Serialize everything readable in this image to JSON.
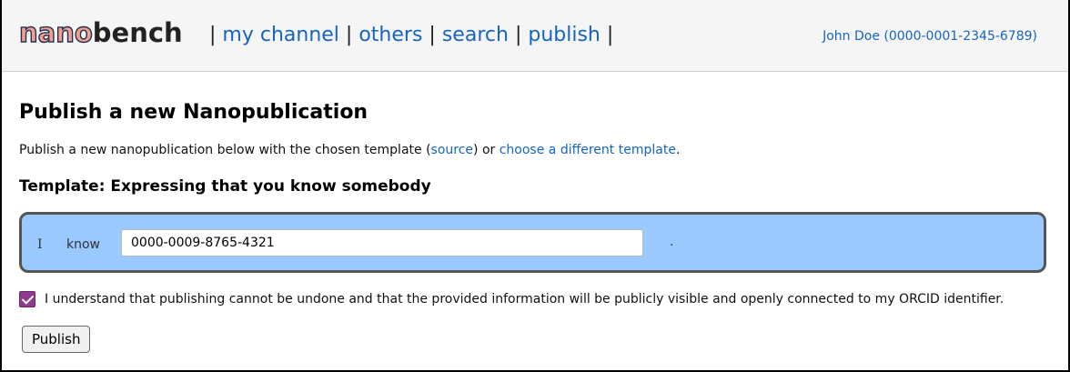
{
  "header": {
    "logo": {
      "part1": "nano",
      "part2": "bench"
    },
    "nav": {
      "sep": "|",
      "items": [
        {
          "label": "my channel"
        },
        {
          "label": "others"
        },
        {
          "label": "search"
        },
        {
          "label": "publish"
        }
      ]
    },
    "user": "John Doe (0000-0001-2345-6789)"
  },
  "main": {
    "title": "Publish a new Nanopublication",
    "intro": {
      "before": "Publish a new nanopublication below with the chosen template (",
      "source_link": "source",
      "middle": ") or ",
      "change_link": "choose a different template",
      "after": "."
    },
    "template_heading": "Template: Expressing that you know somebody",
    "statement": {
      "subject": "I",
      "predicate": "know",
      "object_value": "0000-0009-8765-4321",
      "terminator": "."
    },
    "consent": {
      "checked": true,
      "text": "I understand that publishing cannot be undone and that the provided information will be publicly visible and openly connected to my ORCID identifier."
    },
    "publish_button": "Publish"
  },
  "colors": {
    "link": "#1565c0",
    "statement_bg": "#99c9fe",
    "checkbox": "#8e3b8e",
    "logo_nano": "#f1a18b"
  }
}
